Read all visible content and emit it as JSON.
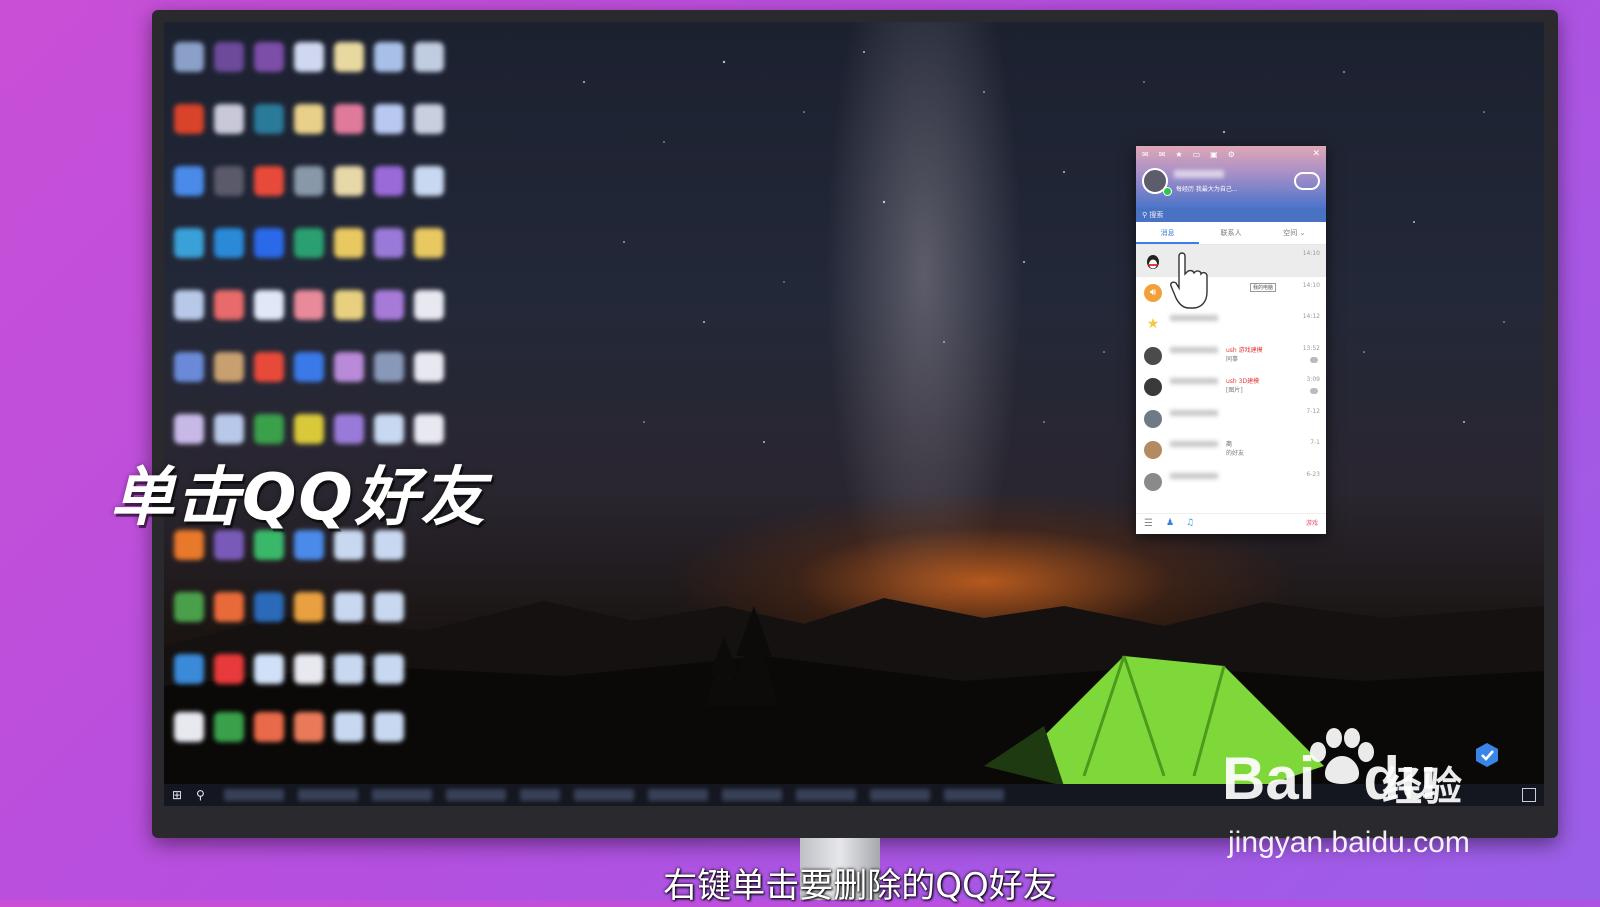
{
  "overlay": {
    "title": "单击QQ好友",
    "subtitle": "右键单击要删除的QQ好友"
  },
  "watermark": {
    "brand": "Bai",
    "brand_du": "du",
    "jingyan": "经验",
    "url": "jingyan.baidu.com"
  },
  "qq": {
    "signature": "每经历 我最大为自己...",
    "search_placeholder": "搜索",
    "tabs": [
      "消息",
      "联系人",
      "空间 ⌄"
    ],
    "tooltip": "我的电脑",
    "rows": [
      {
        "time": "14:10",
        "sub": "",
        "sub2": "",
        "avatar_color": "#e8e8e8"
      },
      {
        "time": "14:10",
        "sub": "",
        "sub2": "",
        "avatar_color": "#f2a13a"
      },
      {
        "time": "14:12",
        "sub": "",
        "sub2": "",
        "avatar_color": "#f5c842"
      },
      {
        "time": "13:52",
        "sub": "ush 游戏建模",
        "sub2": "同事",
        "avatar_color": "#4b4b4b"
      },
      {
        "time": "3:09",
        "sub": "ush 3D建模",
        "sub2": "[图片]",
        "avatar_color": "#3a3a3a"
      },
      {
        "time": "7-12",
        "sub": "",
        "sub2": "",
        "avatar_color": "#6f7a86"
      },
      {
        "time": "7-1",
        "sub": "商",
        "sub2": "的好友",
        "avatar_color": "#b48a62"
      },
      {
        "time": "6-23",
        "sub": "",
        "sub2": "",
        "avatar_color": "#8a8a8a"
      }
    ],
    "footer_game_label": "游戏"
  },
  "colors": {
    "qq_accent": "#3a7ee6",
    "tent_green": "#7fd83a"
  }
}
